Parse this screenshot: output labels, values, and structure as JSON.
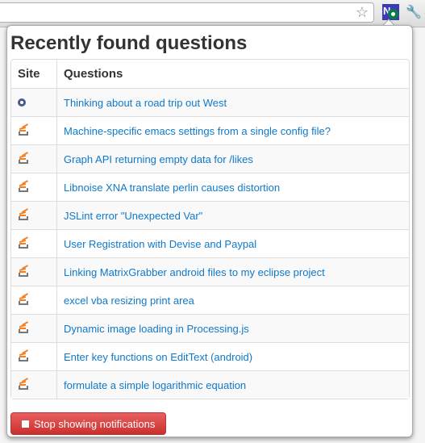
{
  "popup": {
    "title": "Recently found questions",
    "table": {
      "headers": [
        "Site",
        "Questions"
      ],
      "rows": [
        {
          "site_icon": "gear-site-icon",
          "question": "Thinking about a road trip out West"
        },
        {
          "site_icon": "stackoverflow-icon",
          "question": "Machine-specific emacs settings from a single config file?"
        },
        {
          "site_icon": "stackoverflow-icon",
          "question": "Graph API returning empty data for /likes"
        },
        {
          "site_icon": "stackoverflow-icon",
          "question": "Libnoise XNA translate perlin causes distortion"
        },
        {
          "site_icon": "stackoverflow-icon",
          "question": "JSLint error \"Unexpected Var\""
        },
        {
          "site_icon": "stackoverflow-icon",
          "question": "User Registration with Devise and Paypal"
        },
        {
          "site_icon": "stackoverflow-icon",
          "question": "Linking MatrixGrabber android files to my eclipse project"
        },
        {
          "site_icon": "stackoverflow-icon",
          "question": "excel vba resizing print area"
        },
        {
          "site_icon": "stackoverflow-icon",
          "question": "Dynamic image loading in Processing.js"
        },
        {
          "site_icon": "stackoverflow-icon",
          "question": "Enter key functions on EditText (android)"
        },
        {
          "site_icon": "stackoverflow-icon",
          "question": "formulate a simple logarithmic equation"
        }
      ]
    },
    "stop_button": "Stop showing notifications"
  },
  "colors": {
    "link": "#0f79c9",
    "danger": "#c9302c"
  }
}
